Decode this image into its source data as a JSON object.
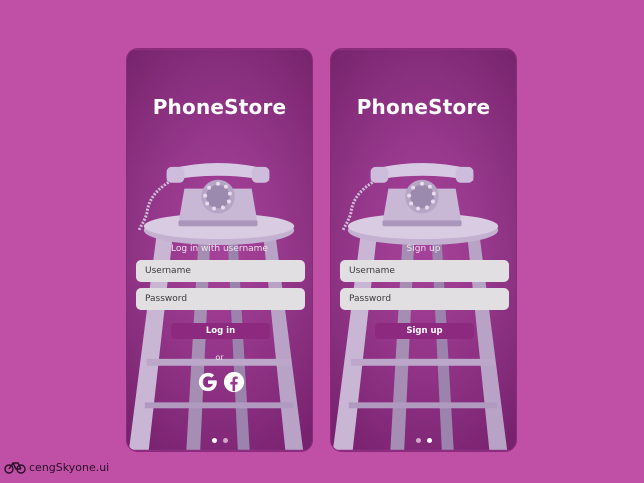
{
  "colors": {
    "background": "#c04fa6",
    "button": "#8d2a80",
    "field": "#e2dfe2"
  },
  "login_screen": {
    "title": "PhoneStore",
    "caption": "Log in with username",
    "username_placeholder": "Username",
    "password_placeholder": "Password",
    "button_label": "Log in",
    "or_label": "or",
    "social_icons": [
      "google-icon",
      "facebook-icon"
    ],
    "page_indicator": {
      "count": 2,
      "active": 1
    }
  },
  "signup_screen": {
    "title": "PhoneStore",
    "caption": "Sign up",
    "username_placeholder": "Username",
    "password_placeholder": "Password",
    "button_label": "Sign up",
    "page_indicator": {
      "count": 2,
      "active": 2
    }
  },
  "footer": {
    "brand": "cengSkyone.ui",
    "logo_icon": "bicycle-icon"
  }
}
